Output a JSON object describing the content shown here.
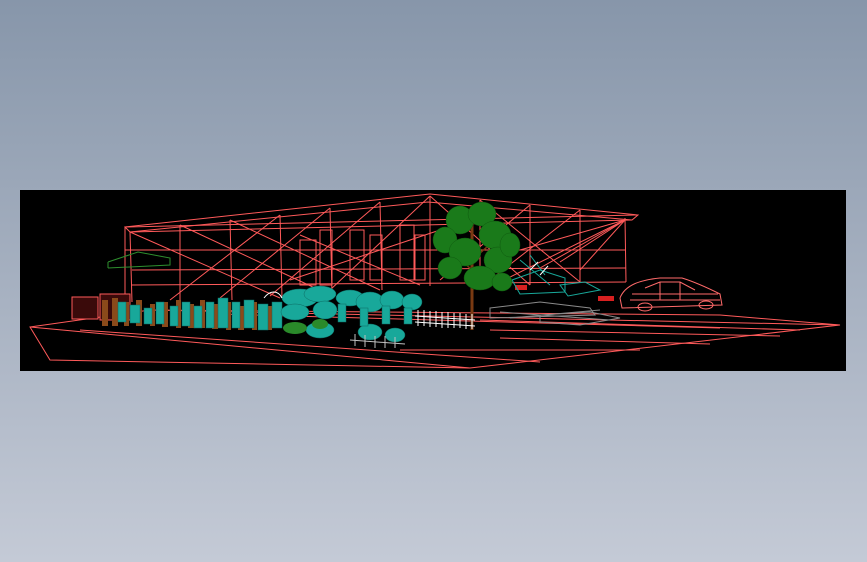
{
  "app": {
    "type": "cad-3d-wireframe-preview"
  },
  "background": {
    "top_color": "#8796aa",
    "bottom_color": "#c4cad6"
  },
  "viewport": {
    "background_color": "#000000",
    "render_mode": "wireframe",
    "colors": {
      "wireframe": "#ff5a5a",
      "foliage": "#1a7a1a",
      "trunk": "#7a3a12",
      "plants": "#18a89a",
      "fence": "#ffffff",
      "brown_fence": "#8a4a1a",
      "car": "#ff6a6a"
    },
    "objects": [
      "building-frame",
      "ground-plane",
      "tree",
      "shrubs",
      "fence",
      "car"
    ]
  }
}
